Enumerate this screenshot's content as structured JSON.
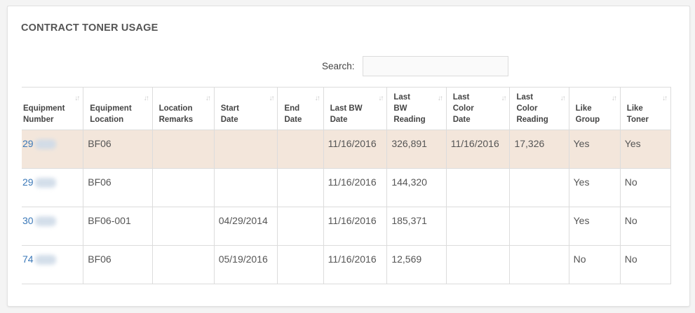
{
  "panel": {
    "title": "CONTRACT TONER USAGE"
  },
  "search": {
    "label": "Search:",
    "value": "",
    "placeholder": ""
  },
  "table": {
    "columns": [
      {
        "line1": "Equipment",
        "line2": "Number",
        "line3": ""
      },
      {
        "line1": "Equipment",
        "line2": "Location",
        "line3": ""
      },
      {
        "line1": "Location",
        "line2": "Remarks",
        "line3": ""
      },
      {
        "line1": "Start",
        "line2": "Date",
        "line3": ""
      },
      {
        "line1": "End",
        "line2": "Date",
        "line3": ""
      },
      {
        "line1": "Last BW",
        "line2": "Date",
        "line3": ""
      },
      {
        "line1": "Last",
        "line2": "BW",
        "line3": "Reading"
      },
      {
        "line1": "Last",
        "line2": "Color",
        "line3": "Date"
      },
      {
        "line1": "Last",
        "line2": "Color",
        "line3": "Reading"
      },
      {
        "line1": "Like",
        "line2": "Group",
        "line3": ""
      },
      {
        "line1": "Like",
        "line2": "Toner",
        "line3": ""
      }
    ],
    "rows": [
      {
        "equipment_number": "29",
        "equipment_location": "BF06",
        "location_remarks": "",
        "start_date": "",
        "end_date": "",
        "last_bw_date": "11/16/2016",
        "last_bw_reading": "326,891",
        "last_color_date": "11/16/2016",
        "last_color_reading": "17,326",
        "like_group": "Yes",
        "like_toner": "Yes"
      },
      {
        "equipment_number": "29",
        "equipment_location": "BF06",
        "location_remarks": "",
        "start_date": "",
        "end_date": "",
        "last_bw_date": "11/16/2016",
        "last_bw_reading": "144,320",
        "last_color_date": "",
        "last_color_reading": "",
        "like_group": "Yes",
        "like_toner": "No"
      },
      {
        "equipment_number": "30",
        "equipment_location": "BF06-001",
        "location_remarks": "",
        "start_date": "04/29/2014",
        "end_date": "",
        "last_bw_date": "11/16/2016",
        "last_bw_reading": "185,371",
        "last_color_date": "",
        "last_color_reading": "",
        "like_group": "Yes",
        "like_toner": "No"
      },
      {
        "equipment_number": "74",
        "equipment_location": "BF06",
        "location_remarks": "",
        "start_date": "05/19/2016",
        "end_date": "",
        "last_bw_date": "11/16/2016",
        "last_bw_reading": "12,569",
        "last_color_date": "",
        "last_color_reading": "",
        "like_group": "No",
        "like_toner": "No"
      }
    ],
    "sort_icon": "sort-arrows-icon"
  },
  "colors": {
    "highlight_row": "#f3e6db",
    "link": "#3a78b8",
    "border": "#dcdcdc"
  }
}
